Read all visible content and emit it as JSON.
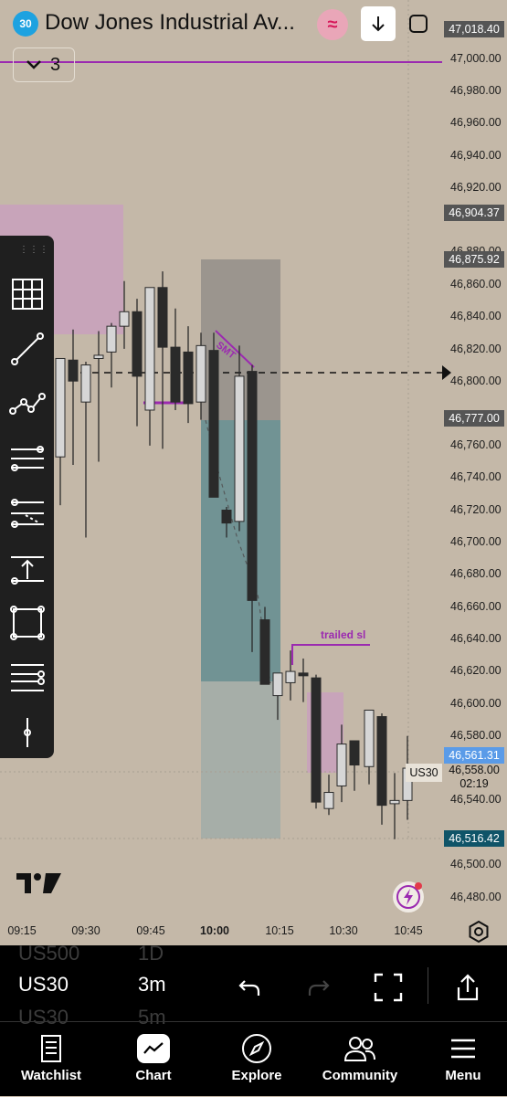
{
  "header": {
    "badge": "30",
    "title": "Dow Jones Industrial Av...",
    "wave_icon": "wave-icon",
    "dropdown_count": "3"
  },
  "price_axis": {
    "ticks": [
      "47,000.00",
      "46,980.00",
      "46,960.00",
      "46,940.00",
      "46,920.00",
      "46,880.00",
      "46,860.00",
      "46,840.00",
      "46,820.00",
      "46,800.00",
      "46,760.00",
      "46,740.00",
      "46,720.00",
      "46,700.00",
      "46,680.00",
      "46,660.00",
      "46,640.00",
      "46,620.00",
      "46,600.00",
      "46,580.00",
      "46,540.00",
      "46,500.00",
      "46,480.00"
    ],
    "labels": {
      "top": "47,018.40",
      "l2": "46,904.37",
      "l3": "46,875.92",
      "l4": "46,777.00",
      "current": "46,561.31",
      "last": "46,558.00",
      "countdown": "02:19",
      "low": "46,516.42"
    }
  },
  "time_axis": [
    "09:15",
    "09:30",
    "09:45",
    "10:00",
    "10:15",
    "10:30",
    "10:45"
  ],
  "chart": {
    "symbol_tag": "US30",
    "smt_label": "SMT",
    "trailed_label": "trailed sl",
    "colors": {
      "up": "#d6d6d6",
      "down": "#2a2a2a",
      "accent": "#9b2ab0",
      "profit": "#5d8a8f",
      "loss": "#8e8a86",
      "zone": "#c9a0bd"
    }
  },
  "bottom": {
    "symbols": {
      "prev": "US500",
      "current": "US30",
      "next": "US30"
    },
    "timeframes": {
      "prev": "1D",
      "current": "3m",
      "next": "5m"
    }
  },
  "nav": [
    {
      "label": "Watchlist",
      "icon": "watchlist-icon"
    },
    {
      "label": "Chart",
      "icon": "chart-icon"
    },
    {
      "label": "Explore",
      "icon": "compass-icon"
    },
    {
      "label": "Community",
      "icon": "community-icon"
    },
    {
      "label": "Menu",
      "icon": "menu-icon"
    }
  ]
}
